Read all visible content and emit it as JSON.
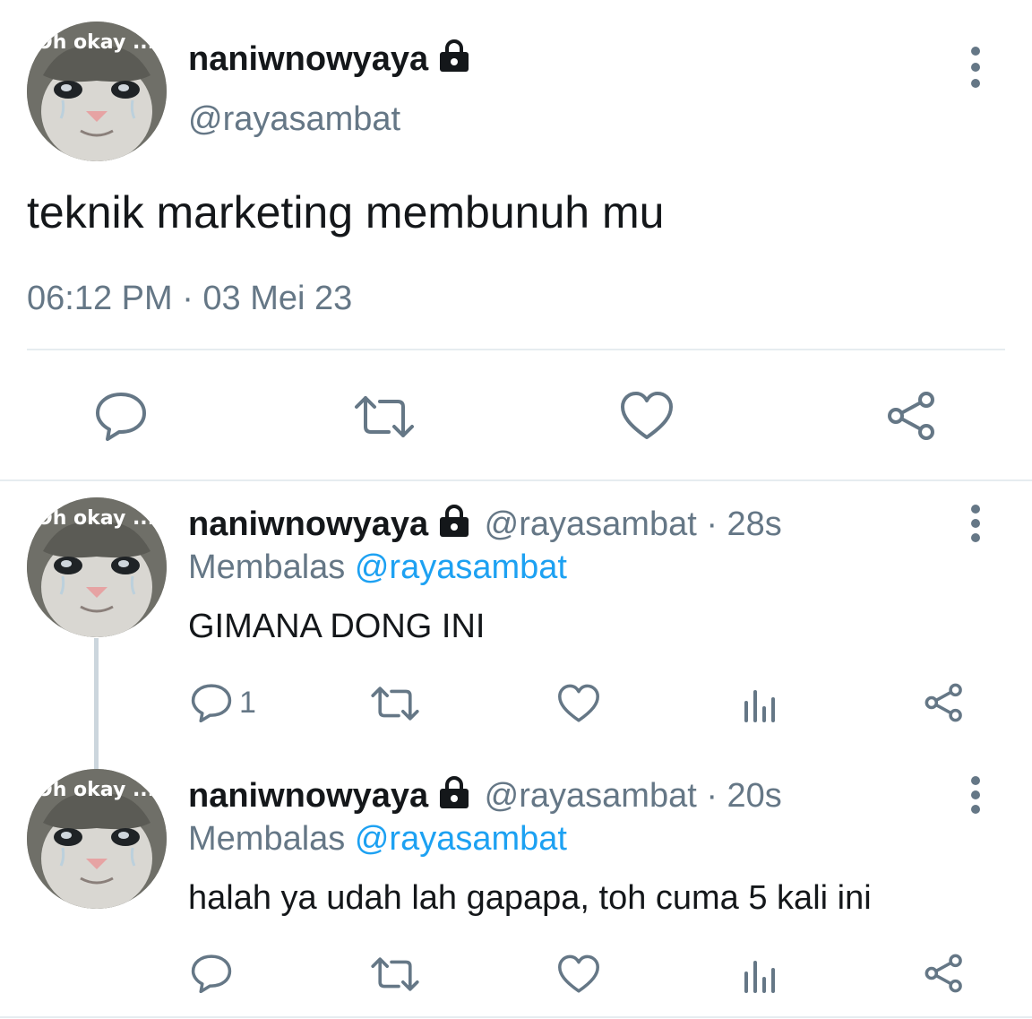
{
  "colors": {
    "text": "#14171a",
    "muted": "#657786",
    "link": "#1da1f2",
    "divider": "#e6ecf0"
  },
  "avatar": {
    "caption": "Oh okay ...",
    "icon": "crying-cat-avatar"
  },
  "main_tweet": {
    "display_name": "naniwnowyaya",
    "handle": "@rayasambat",
    "text": "teknik marketing membunuh mu",
    "timestamp": "06:12 PM · 03 Mei 23",
    "actions": [
      "reply-icon",
      "retweet-icon",
      "like-icon",
      "share-icon"
    ]
  },
  "replies": [
    {
      "display_name": "naniwnowyaya",
      "handle_time": "@rayasambat · 28s",
      "replying_prefix": "Membalas",
      "replying_to": "@rayasambat",
      "text": "GIMANA DONG INI",
      "reply_count": "1"
    },
    {
      "display_name": "naniwnowyaya",
      "handle_time": "@rayasambat · 20s",
      "replying_prefix": "Membalas",
      "replying_to": "@rayasambat",
      "text": "halah ya udah lah gapapa, toh cuma 5 kali ini",
      "reply_count": ""
    }
  ]
}
